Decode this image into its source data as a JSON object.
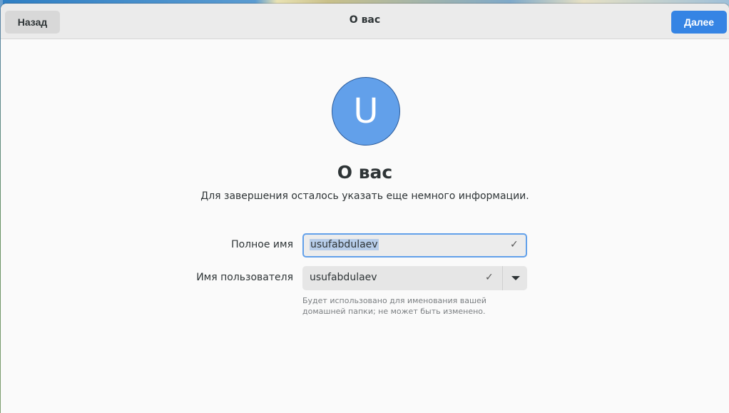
{
  "window": {
    "title": "О вас",
    "back_label": "Назад",
    "next_label": "Далее"
  },
  "avatar": {
    "initial": "U",
    "color": "#62a0ea"
  },
  "main": {
    "title": "О вас",
    "subtitle": "Для завершения осталось указать еще немного информации."
  },
  "form": {
    "full_name": {
      "label": "Полное имя",
      "value": "usufabdulaev",
      "icon": "check-icon",
      "selected": true
    },
    "username": {
      "label": "Имя пользователя",
      "value": "usufabdulaev",
      "icon": "check-icon"
    },
    "hint": "Будет использовано для именования вашей домашней папки; не может быть изменено."
  },
  "colors": {
    "accent": "#3584e4",
    "focus": "#62a0ea"
  }
}
